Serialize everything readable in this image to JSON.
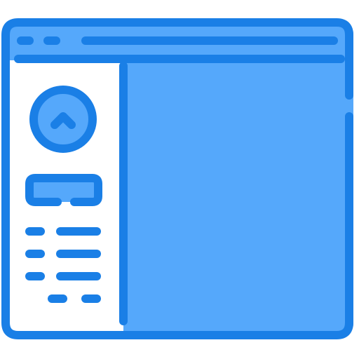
{
  "icon": {
    "name": "browser-window-profile-layout-icon",
    "colors": {
      "stroke": "#1A7FE6",
      "fill": "#55A8FB",
      "panel": "#FFFFFF"
    }
  }
}
